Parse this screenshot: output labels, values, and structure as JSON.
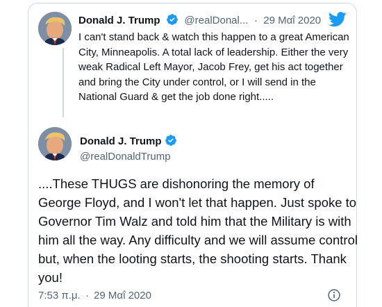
{
  "colors": {
    "accent": "#1d9bf0",
    "text": "#0f1419",
    "muted": "#536471",
    "border": "#cfd9de"
  },
  "quoted_tweet": {
    "author_name": "Donald J. Trump",
    "handle": "@realDonal...",
    "separator": "·",
    "date": "29 Μαΐ 2020",
    "text": "I can't stand back & watch this happen to a great American City, Minneapolis. A total lack of leadership. Either the very weak Radical Left Mayor, Jacob Frey, get his act together and bring the City under control, or I will send in the National Guard & get the job done right.....",
    "icons": [
      "avatar",
      "verified-badge-icon",
      "twitter-bird-icon"
    ]
  },
  "main_tweet": {
    "author_name": "Donald J. Trump",
    "handle": "@realDonaldTrump",
    "text": "....These THUGS are dishonoring the memory of George Floyd, and I won't let that happen. Just spoke to Governor Tim Walz and told him that the Military is with him all the way. Any difficulty and we will assume control but, when the looting starts, the shooting starts. Thank you!",
    "time": "7:53 π.μ.",
    "separator": "·",
    "date": "29 Μαΐ 2020",
    "icons": [
      "avatar",
      "verified-badge-icon",
      "info-icon"
    ]
  }
}
